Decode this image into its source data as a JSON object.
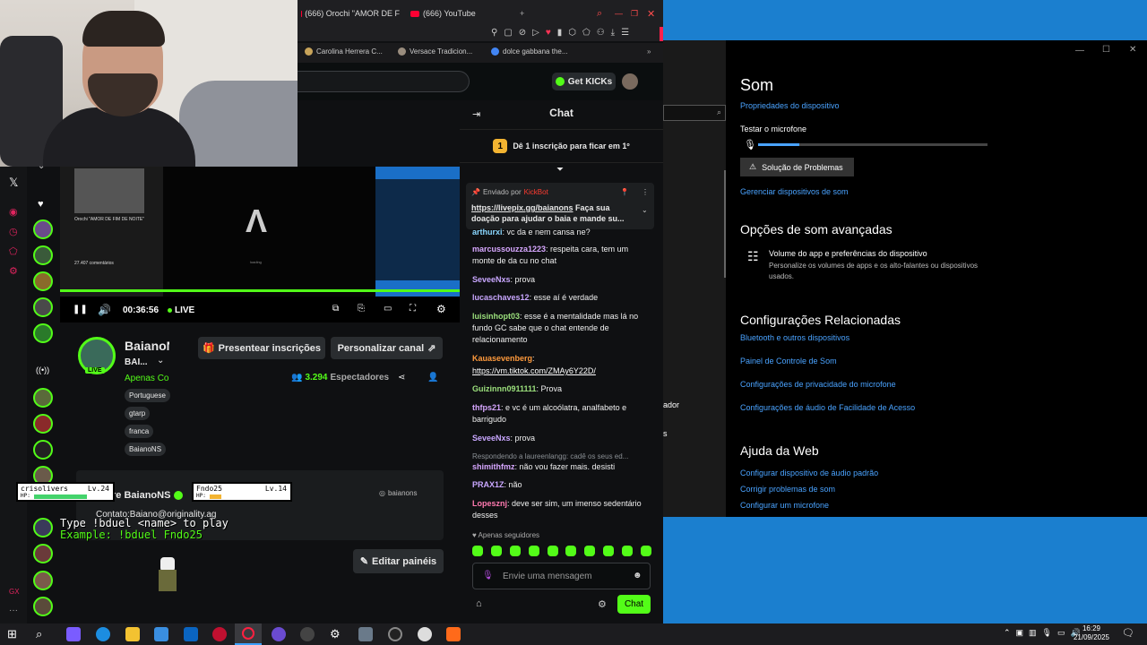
{
  "browser": {
    "tabs": [
      {
        "label": "(666) Orochi \"AMOR DE F"
      },
      {
        "label": "(666) YouTube"
      }
    ],
    "bookmarks": [
      "Carolina Herrera C...",
      "Versace Tradicion...",
      "dolce gabbana the..."
    ]
  },
  "kick_header": {
    "get_kicks_label": "Get KICKs"
  },
  "player": {
    "time": "00:36:56",
    "live_label": "LIVE",
    "embedded": {
      "video_title": "Orochi \"AMOR DE FIM DE NOITE\"",
      "comments": "27.407 comentários",
      "overlay_line1": "Type !bduel <name> to play",
      "overlay_line2": "Example: !bduel Fndo25",
      "loading": "loading"
    }
  },
  "channel": {
    "name": "BaianoN",
    "subname": "BAI...",
    "category": "Apenas Co",
    "live_badge": "LIVE",
    "tags": [
      "Portuguese",
      "gtarp",
      "franca",
      "BaianoNS"
    ],
    "gift_button": "Presentear inscrições",
    "customize_button": "Personalizar canal",
    "viewers_count": "3.294",
    "viewers_label": "Espectadores",
    "about_name": "re BaianoNS",
    "about_handle": "baianons",
    "contact": "Contato:Baiano@originality.ag",
    "edit_panels": "Editar painéis"
  },
  "game_overlay": {
    "player1": {
      "name": "crisolivers",
      "level": "Lv.24",
      "hp_label": "HP:",
      "hp": 0.7
    },
    "player2": {
      "name": "Fndo25",
      "level": "Lv.14",
      "hp_label": "HP:",
      "hp": 0.15
    },
    "line1": "Type !bduel <name> to play",
    "line2": "Example: !bduel Fndo25"
  },
  "chat": {
    "title": "Chat",
    "sub_goal": "Dê 1 inscrição para ficar em 1º",
    "sub_goal_rank": "1",
    "pinned": {
      "sent_by": "Enviado por",
      "sender": "KickBot",
      "link": "https://livepix.gg/baianons",
      "text": " Faça sua doação para ajudar o baia e mande su..."
    },
    "messages": [
      {
        "user": "arthurxi",
        "text": ": vc da e nem cansa ne?",
        "color": "#8ad7ff"
      },
      {
        "user": "marcussouzza1223",
        "text": ": respeita cara, tem um monte de da cu no chat",
        "color": "#d7a7ff"
      },
      {
        "user": "SeveeNxs",
        "text": ": prova",
        "color": "#c9a7ff"
      },
      {
        "user": "lucaschaves12",
        "text": ": esse aí é verdade",
        "color": "#c9a7ff"
      },
      {
        "user": "luisinhopt03",
        "text": ": esse é a mentalidade mas lá no fundo GC sabe que o chat entende de relacionamento",
        "color": "#9be07c"
      },
      {
        "user": "Kauasevenberg",
        "text": ":",
        "color": "#ff9a3c"
      },
      {
        "user": "",
        "text": "https://vm.tiktok.com/ZMAy6Y22D/",
        "color": "#ffffff"
      },
      {
        "user": "Guizinnn0911111",
        "text": ": Prova",
        "color": "#9be07c"
      },
      {
        "user": "thfps21",
        "text": ": e vc é um alcoólatra, analfabeto e barrigudo",
        "color": "#d7a7ff"
      },
      {
        "user": "SeveeNxs",
        "text": ": prova",
        "color": "#c9a7ff"
      },
      {
        "user": "",
        "text": "Respondendo a laureenlangg: cadê os seus ed...",
        "color": "#8a8f94"
      },
      {
        "user": "shimithfmz",
        "text": ": não vou fazer mais. desisti",
        "color": "#d7a7ff"
      },
      {
        "user": "PRAX1Z",
        "text": ": não",
        "color": "#c9a7ff"
      },
      {
        "user": "Lopesznj",
        "text": ": deve ser sim, um imenso sedentário desses",
        "color": "#ff7ab0"
      }
    ],
    "followers_only": "Apenas seguidores",
    "input_placeholder": "Envie uma mensagem",
    "send_label": "Chat"
  },
  "settings": {
    "title": "Som",
    "device_props": "Propriedades do dispositivo",
    "test_mic": "Testar o microfone",
    "mic_level": 0.18,
    "troubleshoot": "Solução de Problemas",
    "manage_devices": "Gerenciar dispositivos de som",
    "advanced_title": "Opções de som avançadas",
    "app_volume_title": "Volume do app e preferências do dispositivo",
    "app_volume_desc": "Personalize os volumes de apps e os alto-falantes ou dispositivos usados.",
    "related_title": "Configurações Relacionadas",
    "related_links": [
      "Bluetooth e outros dispositivos",
      "Painel de Controle de Som",
      "Configurações de privacidade do microfone",
      "Configurações de áudio de Facilidade de Acesso"
    ],
    "help_title": "Ajuda da Web",
    "help_links": [
      "Configurar dispositivo de áudio padrão",
      "Corrigir problemas de som",
      "Configurar um microfone"
    ],
    "frag1": "ador",
    "frag2": "s"
  },
  "taskbar": {
    "time": "16:29",
    "date": "21/09/2025"
  }
}
